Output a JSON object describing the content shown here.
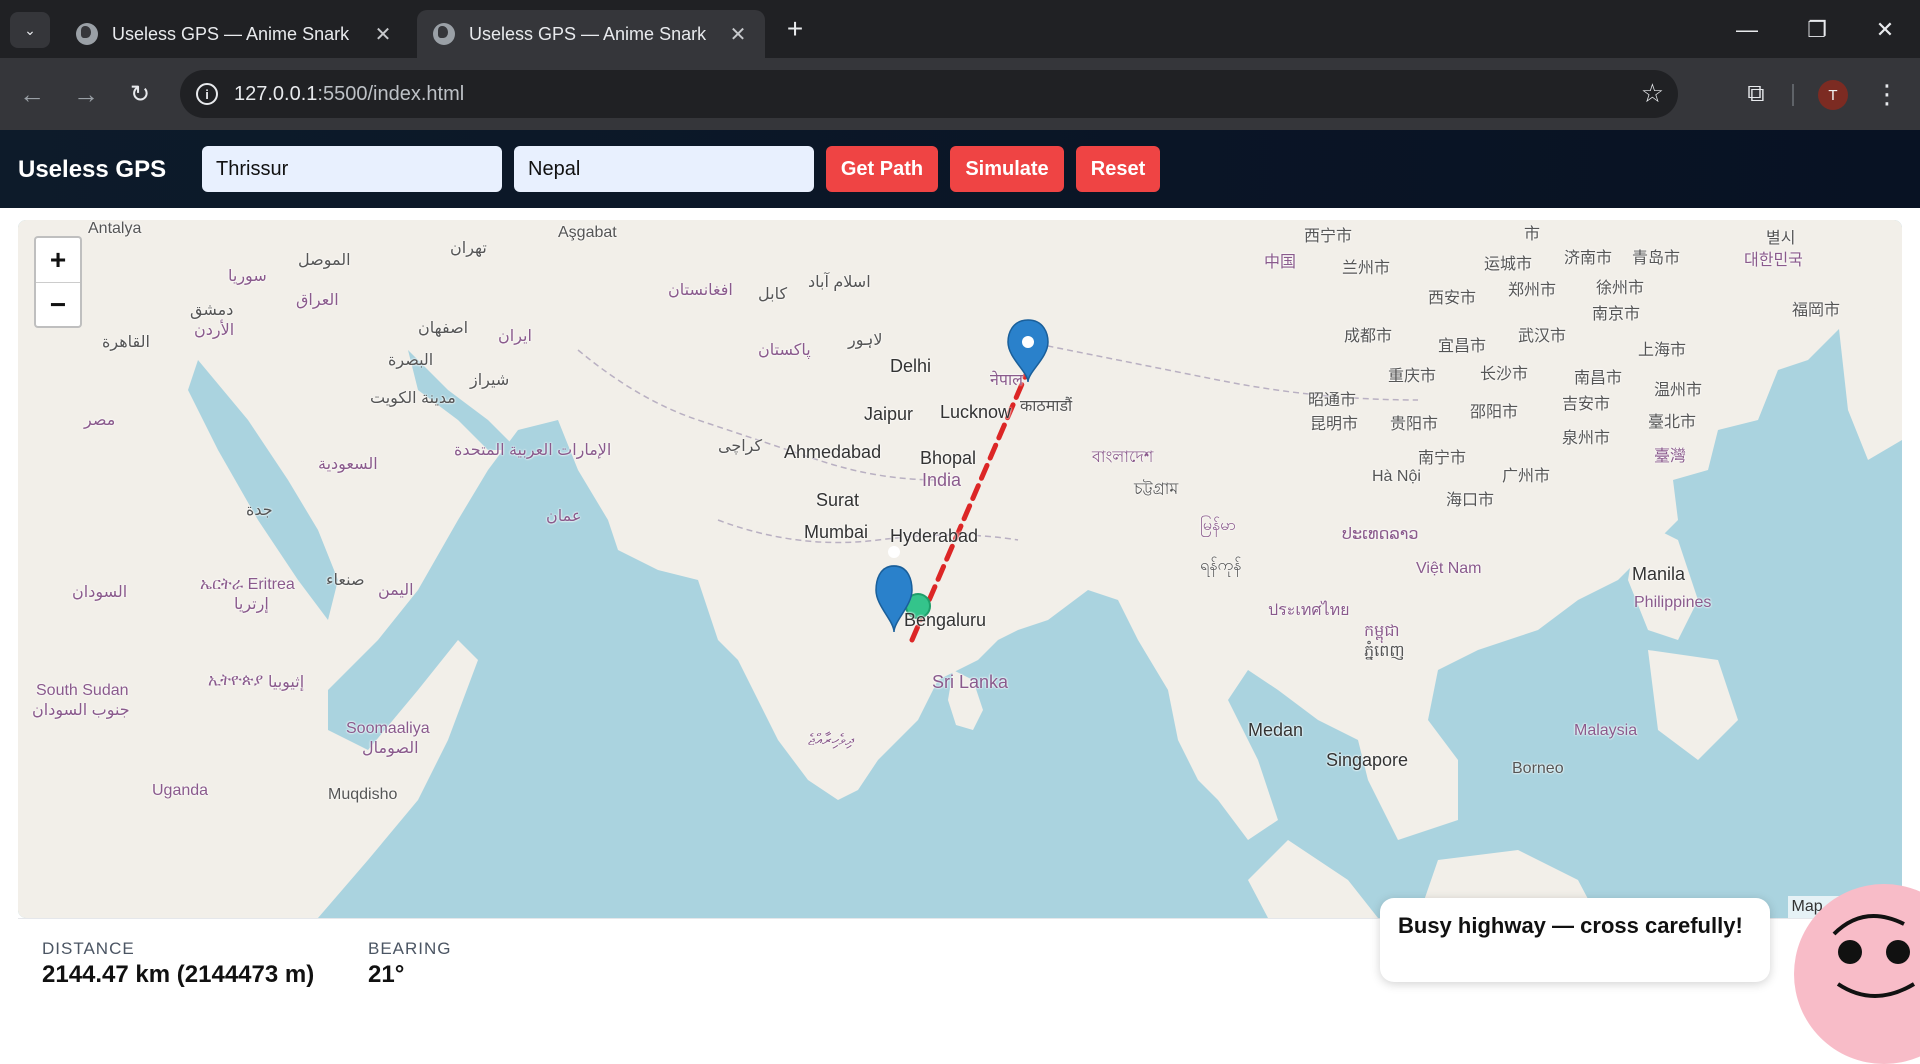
{
  "browser": {
    "tabs": [
      {
        "title": "Useless GPS — Anime Snark"
      },
      {
        "title": "Useless GPS — Anime Snark"
      }
    ],
    "url_host": "127.0.0.1",
    "url_rest": ":5500/index.html",
    "avatar_letter": "T"
  },
  "app": {
    "brand": "Useless GPS",
    "from_value": "Thrissur",
    "to_value": "Nepal",
    "buttons": {
      "get_path": "Get Path",
      "simulate": "Simulate",
      "reset": "Reset"
    }
  },
  "map": {
    "labels": {
      "antalya": "Antalya",
      "asgabat": "Aşgabat",
      "tehran": "تهران",
      "mosul": "الموصل",
      "syria": "سوريا",
      "iraq": "العراق",
      "damascus": "دمشق",
      "jordan": "الأردن",
      "cairo": "القاهرة",
      "isfahan": "اصفهان",
      "iran": "ایران",
      "basra": "البصرة",
      "shiraz": "شیراز",
      "kuwait": "مدينة الكويت",
      "egypt": "مصر",
      "saudi": "السعودية",
      "uae": "الإمارات العربية المتحدة",
      "oman": "عمان",
      "jeddah": "جدة",
      "sudan": "السودان",
      "eritrea": "ኤርትራ Eritrea",
      "eritrea2": "إرتريا",
      "sanaa": "صنعاء",
      "yemen": "اليمن",
      "ethiopia": "ኢትዮጵያ",
      "ethiopia2": "إثيوبيا",
      "south_sudan": "South Sudan",
      "south_sudan2": "جنوب السودان",
      "somalia": "Soomaaliya",
      "somalia2": "الصومال",
      "uganda": "Uganda",
      "mogadishu": "Muqdisho",
      "afghanistan": "افغانستان",
      "kabul": "کابل",
      "islamabad": "اسلام آباد",
      "lahore": "لاہور",
      "pakistan": "پاکستان",
      "karachi": "کراچی",
      "delhi": "Delhi",
      "jaipur": "Jaipur",
      "lucknow": "Lucknow",
      "ahmedabad": "Ahmedabad",
      "bhopal": "Bhopal",
      "india": "India",
      "surat": "Surat",
      "mumbai": "Mumbai",
      "hyderabad": "Hyderabad",
      "bengaluru": "Bengaluru",
      "srilanka": "Sri Lanka",
      "maldives": "ދިވެހިރާއްޖެ",
      "nepal": "नेपाल",
      "kathmandu": "काठमाडौं",
      "bangladesh": "বাংলাদেশ",
      "chittagong": "চট্টগ্রাম",
      "myanmar": "မြန်မာ",
      "yangon": "ရန်ကုန်",
      "thailand": "ประเทศไทย",
      "cambodia": "កម្ពុជា",
      "phnompenh": "ភ្នំពេញ",
      "laos": "ປະເທດລາວ",
      "vietnam": "Việt Nam",
      "hanoi": "Hà Nội",
      "medan": "Medan",
      "singapore": "Singapore",
      "malaysia": "Malaysia",
      "borneo": "Borneo",
      "manila": "Manila",
      "philippines": "Philippines",
      "xining": "西宁市",
      "lanzhou": "兰州市",
      "china": "中国",
      "shi": "市",
      "yuncheng": "运城市",
      "jinan": "济南市",
      "qingdao": "青岛市",
      "korea": "대한민국",
      "seoul": "별시",
      "fukuoka": "福岡市",
      "xian": "西安市",
      "zhengzhou": "郑州市",
      "xuzhou": "徐州市",
      "nanjing": "南京市",
      "chengdu": "成都市",
      "yichang": "宜昌市",
      "wuhan": "武汉市",
      "shanghai": "上海市",
      "chongqing": "重庆市",
      "changsha": "长沙市",
      "nanchang": "南昌市",
      "wenzhou": "温州市",
      "zhaotong": "昭通市",
      "shaoyang": "邵阳市",
      "jian": "吉安市",
      "kunming": "昆明市",
      "guiyang": "贵阳市",
      "quanzhou": "泉州市",
      "taipei": "臺北市",
      "taiwan": "臺灣",
      "nanning": "南宁市",
      "guangzhou": "广州市",
      "haikou": "海口市"
    },
    "attribution": "Map co"
  },
  "stats": {
    "distance_label": "DISTANCE",
    "distance_value": "2144.47 km (2144473 m)",
    "bearing_label": "BEARING",
    "bearing_value": "21°"
  },
  "toast": {
    "text": "Busy highway — cross carefully!"
  },
  "colors": {
    "accent": "#ef4444",
    "header_bg": "#0d1b2a",
    "route": "#dc2626",
    "sea": "#aad3df",
    "land": "#f2efe9",
    "marker": "#2a81cb"
  }
}
